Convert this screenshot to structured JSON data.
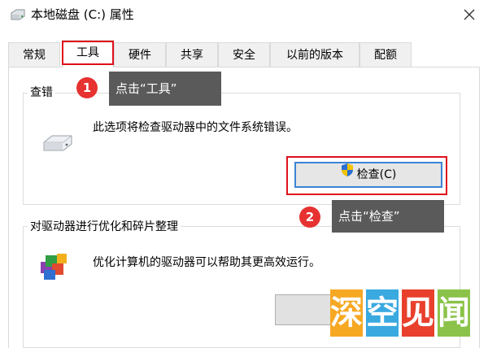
{
  "window": {
    "title": "本地磁盘 (C:) 属性",
    "icons": {
      "title": "drive-icon",
      "close": "close-icon"
    }
  },
  "tabs": [
    {
      "label": "常规",
      "active": false
    },
    {
      "label": "工具",
      "active": true
    },
    {
      "label": "硬件",
      "active": false
    },
    {
      "label": "共享",
      "active": false
    },
    {
      "label": "安全",
      "active": false
    },
    {
      "label": "以前的版本",
      "active": false
    },
    {
      "label": "配额",
      "active": false
    }
  ],
  "error_check": {
    "group_title": "查错",
    "description": "此选项将检查驱动器中的文件系统错误。",
    "button_label": "检查(C)",
    "button_icon": "shield-icon"
  },
  "optimize": {
    "group_title": "对驱动器进行优化和碎片整理",
    "description": "优化计算机的驱动器可以帮助其更高效运行。",
    "button_label": ""
  },
  "callouts": [
    {
      "number": "1",
      "text": "点击“工具”"
    },
    {
      "number": "2",
      "text": "点击“检查”"
    }
  ],
  "watermark": {
    "chars": [
      "深",
      "空",
      "见",
      "闻"
    ],
    "colors": [
      "#f7a823",
      "#3aa9e0",
      "#e8402c",
      "#8bc34a"
    ]
  },
  "colors": {
    "highlight_red": "#e0101a",
    "callout_bg": "#5a5a5a",
    "badge_red": "#e63230",
    "focus_blue": "#3b83d6"
  }
}
